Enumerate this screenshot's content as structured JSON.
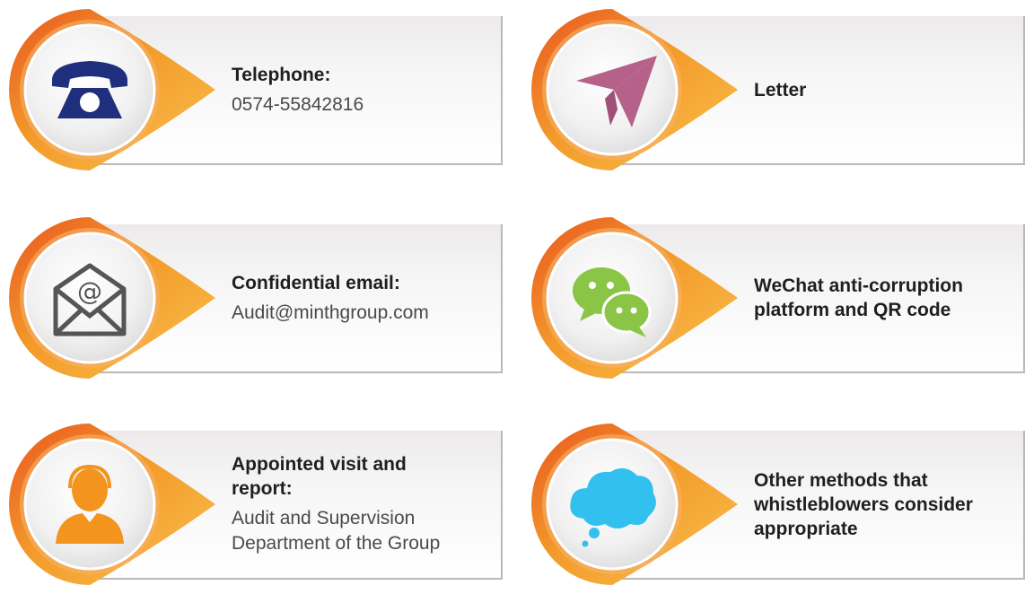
{
  "cards": [
    {
      "title": "Telephone:",
      "body": "0574-55842816",
      "icon": "telephone-icon"
    },
    {
      "title": "Letter",
      "icon": "paper-plane-icon"
    },
    {
      "title": "Confidential email:",
      "body": "Audit@minthgroup.com",
      "icon": "envelope-at-icon"
    },
    {
      "title_line1": "WeChat anti-corruption",
      "title_line2": "platform and QR code",
      "icon": "wechat-icon"
    },
    {
      "title_line1": "Appointed visit and",
      "title_line2": "report:",
      "body_line1": "Audit and Supervision",
      "body_line2": "Department of the Group",
      "icon": "person-headset-icon"
    },
    {
      "title_line1": "Other methods that",
      "title_line2": "whistleblowers consider",
      "title_line3": "appropriate",
      "icon": "thought-cloud-icon"
    }
  ],
  "colors": {
    "orange_dark": "#e9561f",
    "orange": "#f39a2a",
    "orange_light": "#f9be4d",
    "icon_navy": "#1f2f7d",
    "icon_mauve": "#b56189",
    "icon_green": "#8bc546",
    "icon_gray": "#555555",
    "icon_orange": "#f3941f",
    "icon_sky": "#32c1ef"
  }
}
